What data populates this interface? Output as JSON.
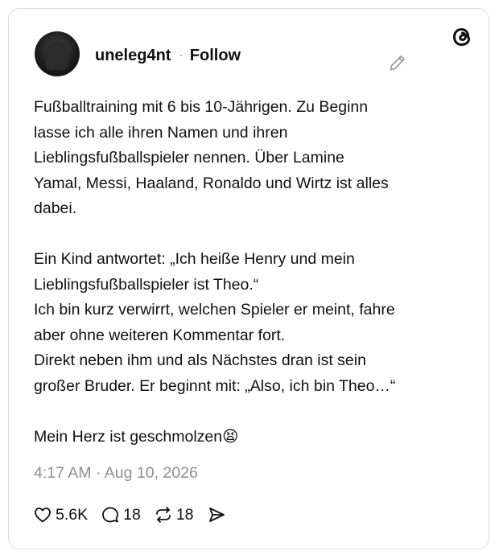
{
  "post": {
    "username": "uneleg4nt",
    "separator": "·",
    "follow_label": "Follow",
    "text": "Fußballtraining mit 6 bis 10-Jährigen. Zu Beginn\nlasse ich alle ihren Namen und ihren\nLieblingsfußballspieler nennen. Über Lamine\nYamal, Messi, Haaland, Ronaldo und Wirtz ist alles\ndabei.\n\nEin Kind antwortet: „Ich heiße Henry und mein\nLieblingsfußballspieler ist Theo.“\nIch bin kurz verwirrt, welchen Spieler er meint, fahre\naber ohne weiteren Kommentar fort.\nDirekt neben ihm und als Nächstes dran ist sein\ngroßer Bruder. Er beginnt mit: „Also, ich bin Theo…“\n\nMein Herz ist geschmolzen😫",
    "timestamp": "4:17 AM · Aug 10, 2026",
    "likes": "5.6K",
    "replies": "18",
    "reposts": "18"
  },
  "icons": {
    "logo": "threads-logo-icon",
    "edit": "pencil-icon",
    "like": "heart-icon",
    "reply": "comment-icon",
    "repost": "repost-icon",
    "share": "send-icon"
  },
  "colors": {
    "text": "#101010",
    "muted": "#8f8f8f",
    "border": "#dcdcdc"
  }
}
